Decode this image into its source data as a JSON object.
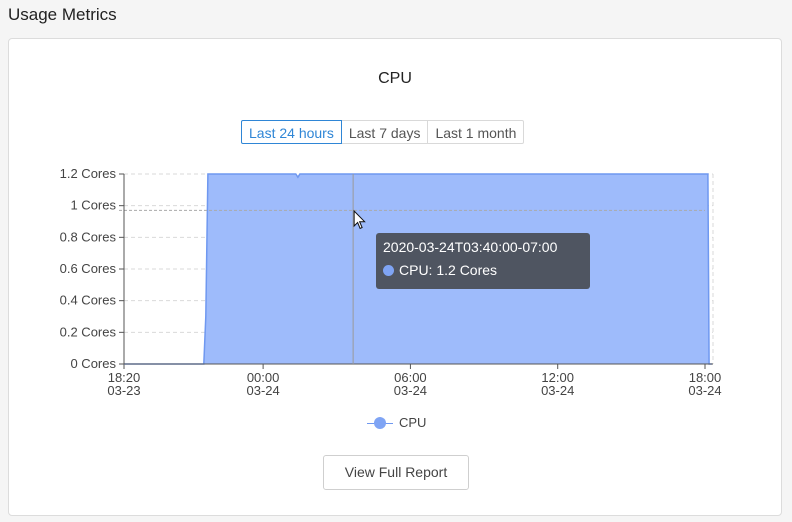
{
  "page": {
    "title": "Usage Metrics"
  },
  "chart_card": {
    "title": "CPU",
    "time_ranges": [
      {
        "label": "Last 24 hours",
        "active": true
      },
      {
        "label": "Last 7 days",
        "active": false
      },
      {
        "label": "Last 1 month",
        "active": false
      }
    ],
    "report_button_label": "View Full Report",
    "tooltip": {
      "time": "2020-03-24T03:40:00-07:00",
      "series_text": "CPU: 1.2 Cores"
    }
  },
  "colors": {
    "series_fill": "#9ebbfb",
    "series_line": "#6f98f0",
    "active_accent": "#2f86d6",
    "tooltip_bg": "#4f5561"
  },
  "chart_data": {
    "type": "area",
    "title": "CPU",
    "xlabel": "",
    "ylabel": "",
    "y_unit": "Cores",
    "yticks": [
      {
        "value": 0,
        "label": "0 Cores"
      },
      {
        "value": 0.2,
        "label": "0.2 Cores"
      },
      {
        "value": 0.4,
        "label": "0.4 Cores"
      },
      {
        "value": 0.6,
        "label": "0.6 Cores"
      },
      {
        "value": 0.8,
        "label": "0.8 Cores"
      },
      {
        "value": 1,
        "label": "1 Cores"
      },
      {
        "value": 1.2,
        "label": "1.2 Cores"
      }
    ],
    "xticks": [
      {
        "value": 0,
        "time": "18:20",
        "date": "03-23"
      },
      {
        "value": 340,
        "time": "00:00",
        "date": "03-24"
      },
      {
        "value": 700,
        "time": "06:00",
        "date": "03-24"
      },
      {
        "value": 1060,
        "time": "12:00",
        "date": "03-24"
      },
      {
        "value": 1420,
        "time": "18:00",
        "date": "03-24"
      }
    ],
    "x_unit": "minutes after 03-23 18:20",
    "ylim": [
      0,
      1.2
    ],
    "xlim": [
      0,
      1420
    ],
    "grid": true,
    "legend_position": "bottom",
    "series": [
      {
        "name": "CPU",
        "x": [
          0,
          195,
          200,
          205,
          420,
          425,
          430,
          1427,
          1430,
          1437
        ],
        "y": [
          0,
          0,
          0.3,
          1.2,
          1.2,
          1.18,
          1.2,
          1.2,
          0,
          0
        ]
      }
    ],
    "reference_lines": [
      0.97
    ],
    "hover_x": 560
  }
}
